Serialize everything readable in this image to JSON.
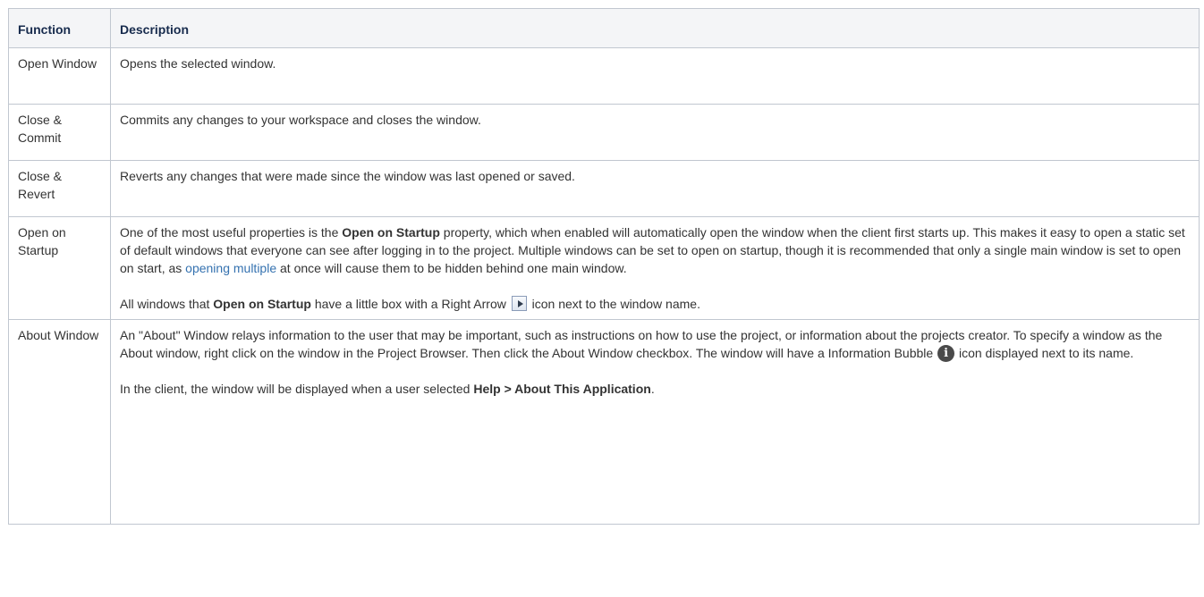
{
  "table": {
    "headers": [
      "Function",
      "Description"
    ],
    "rows": [
      {
        "function": "Open Window",
        "description": "Opens the selected window."
      },
      {
        "function": "Close & Commit",
        "description": "Commits any changes to your workspace and closes the window."
      },
      {
        "function": "Close & Revert",
        "description": "Reverts any changes that were made since the window was last opened or saved."
      },
      {
        "function": "Open on Startup",
        "p1_before": "One of the most useful properties is the ",
        "p1_bold": "Open on Startup",
        "p1_middle": " property, which when enabled will automatically open the window when the client first starts up. This makes it easy to open a static set of default windows that everyone can see after logging in to the project. Multiple windows can be set to open on startup, though it is recommended that only a single main window is set to open on start, as ",
        "p1_link": "opening multiple",
        "p1_after": " at once will cause them to be hidden behind one main window.",
        "p2_before": "All windows that ",
        "p2_bold": "Open on Startup",
        "p2_middle": " have a little box with a Right Arrow ",
        "p2_after": " icon next to the window name.",
        "icon": "right-arrow-box-icon"
      },
      {
        "function": "About Window",
        "p1_before": "An \"About\" Window relays information to the user that may be important, such as instructions on how to use the project, or information about the projects creator. To specify a window as the About window, right click on the window in the Project Browser. Then click the About Window checkbox.  The window will have a Information Bubble ",
        "p1_after": " icon displayed next to its name.",
        "icon": "information-bubble-icon",
        "icon_glyph": "i",
        "p2_before": "In the client, the window will be displayed when a user selected ",
        "p2_bold": "Help > About This Application",
        "p2_after": "."
      }
    ]
  },
  "colors": {
    "border": "#c1c7d0",
    "header_bg": "#f4f5f7",
    "header_text": "#172b4d",
    "link": "#3572b0"
  }
}
